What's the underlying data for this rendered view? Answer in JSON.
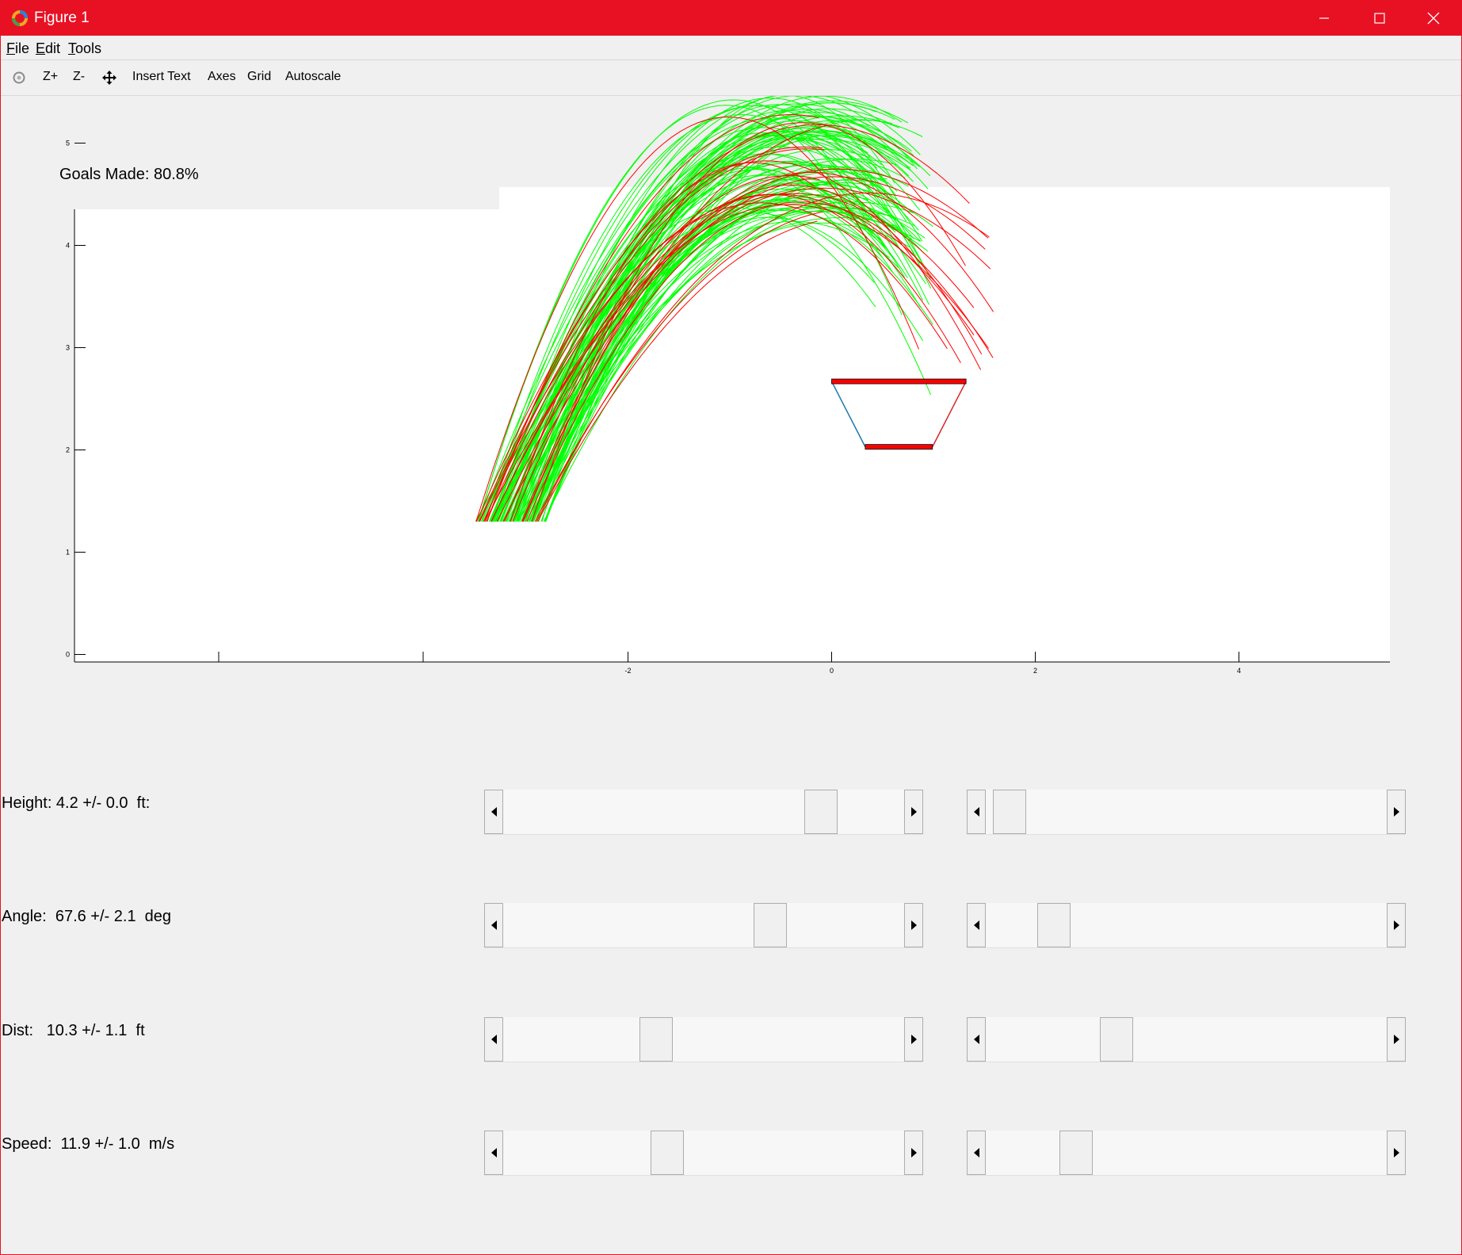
{
  "window": {
    "title": "Figure 1",
    "controls": {
      "minimize": "minimize-icon",
      "maximize": "maximize-icon",
      "close": "close-icon"
    }
  },
  "menu": {
    "file": {
      "mnemonic": "F",
      "rest": "ile"
    },
    "edit": {
      "mnemonic": "E",
      "rest": "dit"
    },
    "tools": {
      "mnemonic": "T",
      "rest": "ools"
    }
  },
  "toolbar": {
    "rotate_icon": "rotate-icon",
    "zoom_in": "Z+",
    "zoom_out": "Z-",
    "pan_icon": "pan-icon",
    "insert_text": "Insert Text",
    "axes": "Axes",
    "grid": "Grid",
    "autoscale": "Autoscale"
  },
  "figure": {
    "goals_made": "Goals Made: 80.8%"
  },
  "chart_data": {
    "type": "line",
    "title": "",
    "xlabel": "",
    "ylabel": "",
    "xlim": [
      -3.7,
      5.4
    ],
    "ylim": [
      -0.05,
      5.3
    ],
    "x_ticks": [
      -2,
      0,
      2,
      4
    ],
    "y_ticks": [
      0,
      1,
      2,
      3,
      4,
      5
    ],
    "grid": false,
    "colors": {
      "made": "#00ff00",
      "missed": "#ff0000",
      "hoop": "#ff0000",
      "hoop_left_side": "#1f77b4",
      "hoop_right_side": "#d62728"
    },
    "hoop": {
      "top_rim": {
        "x": [
          0.0,
          1.32
        ],
        "y": 2.67
      },
      "bottom_rim": {
        "x": [
          0.33,
          0.99
        ],
        "y": 2.03
      }
    },
    "series": [
      {
        "status": "made",
        "count": 101,
        "launch_x_range": [
          -3.5,
          -2.8
        ],
        "launch_y": 1.3,
        "peak_y_range": [
          4.2,
          5.5
        ]
      },
      {
        "status": "missed",
        "count": 24,
        "launch_x_range": [
          -3.5,
          -2.8
        ],
        "launch_y": 1.3,
        "peak_y_range": [
          4.2,
          5.3
        ]
      }
    ]
  },
  "controls": [
    {
      "label": "Height: 4.2 +/- 0.0  ft:",
      "mean_value": 0.82,
      "spread_value": 0.02
    },
    {
      "label": "Angle:  67.6 +/- 2.1  deg",
      "mean_value": 0.68,
      "spread_value": 0.14
    },
    {
      "label": "Dist:   10.3 +/- 1.1  ft",
      "mean_value": 0.37,
      "spread_value": 0.31
    },
    {
      "label": "Speed:  11.9 +/- 1.0  m/s",
      "mean_value": 0.4,
      "spread_value": 0.2
    }
  ]
}
